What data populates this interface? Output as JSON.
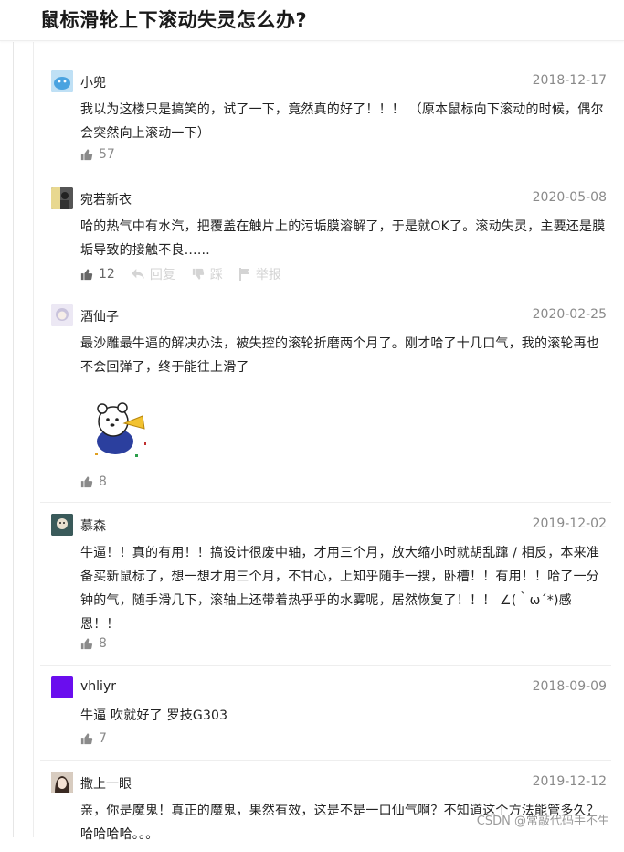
{
  "page": {
    "title": "鼠标滑轮上下滚动失灵怎么办?"
  },
  "watermark": "CSDN @常敲代码手不生",
  "actions_labels": {
    "reply": "回复",
    "dislike": "踩",
    "report": "举报"
  },
  "comments": [
    {
      "username": "小兜",
      "date": "2018-12-17",
      "text": "我以为这楼只是搞笑的，试了一下，竟然真的好了！！！ （原本鼠标向下滚动的时候，偶尔会突然向上滚动一下）",
      "likes": "57",
      "avatar_color": "#7ab8e0"
    },
    {
      "username": "宛若新衣",
      "date": "2020-05-08",
      "text": "哈的热气中有水汽，把覆盖在触片上的污垢膜溶解了，于是就OK了。滚动失灵，主要还是膜垢导致的接触不良……",
      "likes": "12",
      "avatar_color": "#4a4a4a"
    },
    {
      "username": "酒仙子",
      "date": "2020-02-25",
      "text": "最沙雕最牛逼的解决办法，被失控的滚轮折磨两个月了。刚才哈了十几口气，我的滚轮再也不会回弹了，终于能往上滑了",
      "likes": "8",
      "avatar_color": "#d9d6ea"
    },
    {
      "username": "慕森",
      "date": "2019-12-02",
      "text": "牛逼！！真的有用！！搞设计很废中轴，才用三个月，放大缩小时就胡乱蹿 / 相反，本来准备买新鼠标了，想一想才用三个月，不甘心，上知乎随手一搜，卧槽！！有用！！哈了一分钟的气，随手滑几下，滚轴上还带着热乎乎的水雾呢，居然恢复了！！！ ∠(｀ω´*)感恩！！",
      "likes": "8",
      "avatar_color": "#2f4a4a"
    },
    {
      "username": "vhliyr",
      "date": "2018-09-09",
      "text": "牛逼 吹就好了 罗技G303",
      "likes": "7",
      "avatar_color": "#6a0dee"
    },
    {
      "username": "撒上一眼",
      "date": "2019-12-12",
      "text": "亲，你是魔鬼！真正的魔鬼，果然有效，这是不是一口仙气啊？不知道这个方法能管多久？哈哈哈哈。。。",
      "likes": "",
      "avatar_color": "#8a7060"
    }
  ]
}
